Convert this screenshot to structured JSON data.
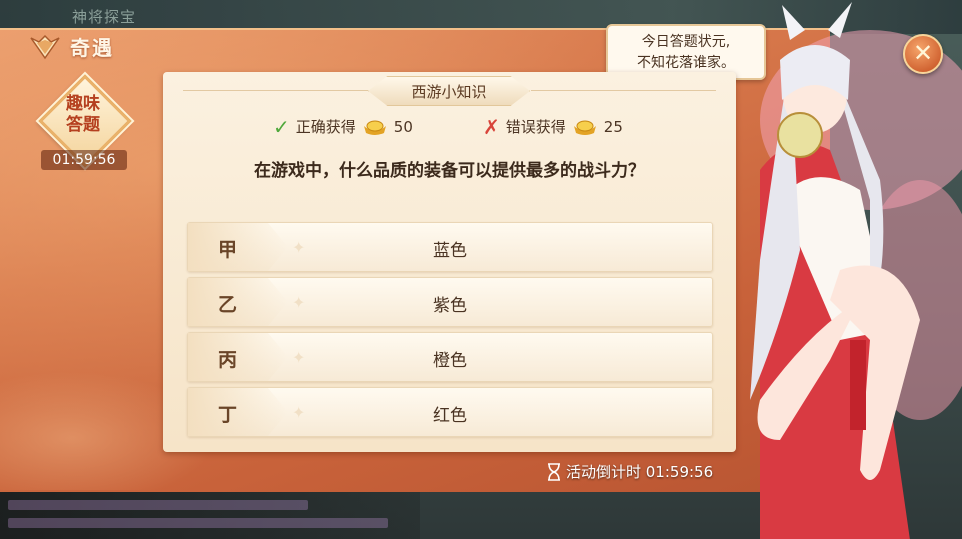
{
  "background": {
    "top_title": "神将探宝"
  },
  "panel": {
    "title": "奇遇",
    "badge_line1": "趣味",
    "badge_line2": "答题",
    "badge_timer": "01:59:56"
  },
  "quiz": {
    "header": "西游小知识",
    "correct_label": "正确获得",
    "correct_amount": "50",
    "wrong_label": "错误获得",
    "wrong_amount": "25",
    "question": "在游戏中，什么品质的装备可以提供最多的战斗力？",
    "options": [
      {
        "letter": "甲",
        "text": "蓝色"
      },
      {
        "letter": "乙",
        "text": "紫色"
      },
      {
        "letter": "丙",
        "text": "橙色"
      },
      {
        "letter": "丁",
        "text": "红色"
      }
    ],
    "countdown_label": "活动倒计时 01:59:56"
  },
  "speech": {
    "line1": "今日答题状元,",
    "line2": "不知花落谁家。"
  },
  "icons": {
    "close": "close-icon",
    "correct": "check-icon",
    "wrong": "cross-icon",
    "currency": "gold-ingot-icon",
    "timer": "hourglass-icon"
  },
  "colors": {
    "panel": "#d7784b",
    "card": "#fbf1e0",
    "correct": "#4fa83b",
    "wrong": "#d8443a"
  }
}
